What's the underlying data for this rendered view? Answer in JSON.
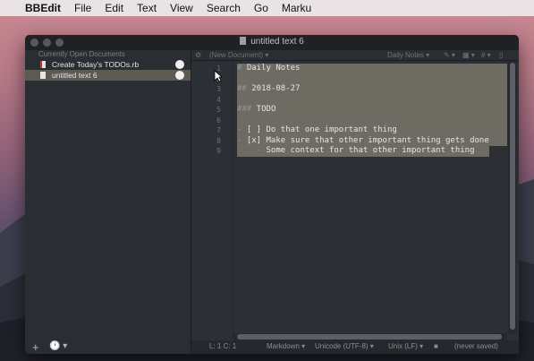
{
  "menubar": {
    "apple": "",
    "app": "BBEdit",
    "items": [
      "File",
      "Edit",
      "Text",
      "View",
      "Search",
      "Go",
      "Marku"
    ]
  },
  "window": {
    "title": "untitled text 6"
  },
  "sidebar": {
    "header": "Currently Open Documents",
    "items": [
      {
        "label": "Create Today's TODOs.rb",
        "selected": false
      },
      {
        "label": "untitled text 6",
        "selected": true
      }
    ],
    "footer": {
      "add": "+",
      "clock": "🕐 ▾"
    }
  },
  "navbar": {
    "gear": "⚙",
    "new_document": "(New Document) ▾",
    "function_menu": "Daily Notes ▾",
    "markers": "✎ ▾",
    "grid": "▦ ▾",
    "hash": "# ▾",
    "doc": "▯"
  },
  "editor": {
    "line_numbers": [
      "1",
      "2",
      "3",
      "4",
      "5",
      "6",
      "7",
      "8",
      "9"
    ],
    "lines": [
      {
        "marker": "#",
        "text": " Daily Notes"
      },
      {
        "marker": "",
        "text": ""
      },
      {
        "marker": "##",
        "text": " 2018-08-27"
      },
      {
        "marker": "",
        "text": ""
      },
      {
        "marker": "###",
        "text": " TODO"
      },
      {
        "marker": "",
        "text": ""
      },
      {
        "marker": "-",
        "text": " [ ] Do that one important thing"
      },
      {
        "marker": "-",
        "text": " [x] Make sure that other important thing gets done"
      },
      {
        "marker": "    -",
        "text": " Some context for that other important thing"
      }
    ]
  },
  "status": {
    "position": "L: 1 C: 1",
    "language": "Markdown ▾",
    "encoding": "Unicode (UTF-8) ▾",
    "line_endings": "Unix (LF) ▾",
    "lock": "■",
    "saved": "(never saved)"
  },
  "colors": {
    "selection": "#6e6b62",
    "editor_bg": "#2c2f33",
    "sidebar_selected": "#5d5a52"
  }
}
